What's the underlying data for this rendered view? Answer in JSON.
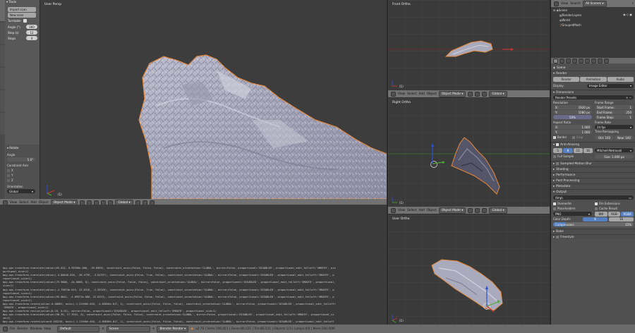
{
  "left_toolshelf": {
    "header": "Tools",
    "buttons": [
      "Import scan",
      "New scan"
    ],
    "turntable_label": "Turntable",
    "fields": [
      {
        "label": "Angle (°)",
        "value": "360"
      },
      {
        "label": "Step (s)",
        "value": "12"
      },
      {
        "label": "Stops",
        "value": "4"
      }
    ],
    "side_tabs": [
      "Tools",
      "Create",
      "Relations",
      "Animation",
      "Physics",
      "Grease Pencil",
      "3D-Print"
    ],
    "rotate_panel": "Rotate",
    "angle_label": "Angle",
    "angle_value": "5.0°",
    "constraint_label": "Constraint Axis",
    "axes": [
      "X",
      "Y",
      "Z"
    ],
    "orientation_label": "Orientation",
    "orientation_value": "Global"
  },
  "main_view": {
    "label": "User Persp",
    "footer_label": "(1)",
    "header": {
      "view": "View",
      "select": "Select",
      "add": "Add",
      "object": "Object",
      "mode": "Object Mode",
      "pivot": "Global"
    }
  },
  "front_view": {
    "label": "Front Ortho",
    "footer_label": "(1)"
  },
  "right_view": {
    "label": "Right Ortho",
    "footer_label": "(1)"
  },
  "user_ortho_view": {
    "label": "User Ortho",
    "footer_label": "(1)"
  },
  "small_header": {
    "view": "View",
    "select": "Select",
    "add": "Add",
    "object": "Object",
    "mode": "Object Mode",
    "global": "Global"
  },
  "outliner": {
    "header": {
      "view": "View",
      "search": "Search",
      "scenes": "All Scenes"
    },
    "items": [
      "Scene",
      "RenderLayers",
      "World",
      "GroupedMesh"
    ]
  },
  "properties": {
    "scene_label": "Scene",
    "render_label": "Render",
    "render_buttons": [
      "Render",
      "Animation",
      "Audio"
    ],
    "display_label": "Display",
    "display_value": "Image Editor",
    "dimensions_label": "Dimensions",
    "render_presets": "Render Presets",
    "resolution_label": "Resolution",
    "frame_range_label": "Frame Range",
    "res_x": "1920 px",
    "res_y": "1080 px",
    "res_pct": "50%",
    "start_frame": "1",
    "end_frame": "250",
    "frame_step": "1",
    "aspect_ratio_label": "Aspect Ratio",
    "frame_rate_label": "Frame Rate",
    "aspect_x": "1.000",
    "aspect_y": "1.000",
    "fps": "24 fps",
    "time_remapping": "Time Remapping",
    "border_label": "Border",
    "crop_label": "Crop",
    "old_label": "Old: 100",
    "new_label": "New: 100",
    "aa_label": "Anti-Aliasing",
    "aa_samples": [
      "5",
      "8",
      "11",
      "16"
    ],
    "aa_filter": "Mitchell-Netravali",
    "full_sample": "Full Sample",
    "size_value": "Size: 1.000 px",
    "collapsed_panels": [
      "Sampled Motion Blur",
      "Shading",
      "Performance",
      "Post Processing",
      "Metadata"
    ],
    "output_label": "Output",
    "output_path": "/tmp\\",
    "overwrite": "Overwrite",
    "file_extensions": "File Extensions",
    "placeholders": "Placeholders",
    "cache_result": "Cache Result",
    "format_value": "PNG",
    "color_buttons": [
      "BW",
      "RGB",
      "RGBA"
    ],
    "color_depth_label": "Color Depth:",
    "color_depth_values": [
      "8",
      "16"
    ],
    "compression_label": "Compression:",
    "compression_value": "15%",
    "bake_label": "Bake",
    "freestyle_label": "Freestyle"
  },
  "console": {
    "lines": [
      "bpy.ops.transform.translate(value=(65.612, 0.95356e-006, -39.0969), constraint_axis=(False, False, False), constraint_orientation='GLOBAL', mirror=False, proportional='DISABLED', proportional_edit_falloff='SMOOTH', pro",
      "portional_size=1)",
      "bpy.ops.transform.translate(value=(-4.80616-016, -38.4739, -3.01337), constraint_axis=(False, True, False), constraint_orientation='GLOBAL', mirror=False, proportional='DISABLED', proportional_edit_falloff='SMOOTH', p",
      "roportional_size=1)",
      "bpy.ops.transform.translate(value=(75.9086, -44.6068, 0), constraint_axis=(False, False, False), constraint_orientation='GLOBAL', mirror=False, proportional='DISABLED', proportional_edit_falloff='SMOOTH', proportional_",
      "size=1)",
      "bpy.ops.transform.translate(value=(-4.79874e-015, 22.6315, -2.55326), constraint_axis=(False, True, False), constraint_orientation='GLOBAL', mirror=False, proportional='DISABLED', proportional_edit_falloff='SMOOTH', p",
      "roportional_size=1)",
      "bpy.ops.transform.translate(value=(95.0841, -4.69571e-008, 22.6315), constraint_axis=(False, False, False), constraint_orientation='GLOBAL', mirror=False, proportional='DISABLED', proportional_edit_falloff='SMOOTH', p",
      "roportional_size=1)",
      "bpy.ops.transform.rotate(value=-0.00663, axis=(-1.21946e-016, -4.85836e-017, 1), constraint_axis=(False, False, False), constraint_orientation='GLOBAL', mirror=False, proportional='DISABLED', proportional_edit_falloff=",
      "'SMOOTH', proportional_size=1)",
      "bpy.ops.transform.resize(value=(0.18, 0.01), mirror=False, proportional='DISABLED', proportional_edit_falloff='SMOOTH', proportional_size=1)",
      "bpy.ops.transform.translate(value=(58.39, 27.3941, 0), constraint_axis=(False, False, False), constraint_orientation='GLOBAL', mirror=False, proportional='DISABLED', proportional_edit_falloff='SMOOTH', proportional_si",
      "ze=1)",
      "bpy.ops.transform.rotate(value=0.203216, axis=(-1.21946e-016, -4.85836e-017, 1), constraint_axis=(False, False, False), constraint_orientation='GLOBAL', mirror=False, proportional='DISABLED', proportional_edit_falloff",
      "='SMOOTH', proportional_size=1)"
    ]
  },
  "statusbar": {
    "menus": [
      "File",
      "Render",
      "Window",
      "Help"
    ],
    "layout": "Default",
    "scene": "Scene",
    "engine": "Blender Render",
    "info": "v2.79 | Verts:106,021 | Faces:80,531 | Tris:80,531 | Objects:1/3 | Lamps:0/0 | Mem:106.00M"
  },
  "colors": {
    "viewport_bg": "#3a3a3a",
    "header_bg": "#727272",
    "selection_outline": "#e8893a",
    "axis_red": "#c8392f",
    "axis_green": "#4fa832",
    "axis_blue": "#2b4fd8"
  }
}
